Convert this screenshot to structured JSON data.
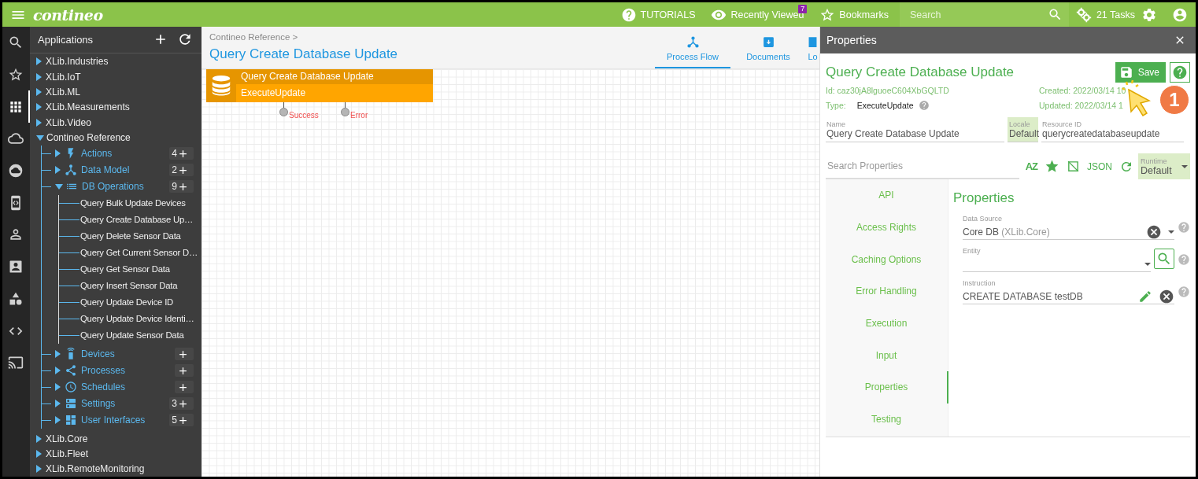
{
  "topbar": {
    "logo": "contineo",
    "links": [
      {
        "kind": "help",
        "label": "TUTORIALS"
      },
      {
        "kind": "eye",
        "label": "Recently Viewed",
        "badge": "7"
      },
      {
        "kind": "star",
        "label": "Bookmarks"
      }
    ],
    "search": {
      "placeholder": "Search"
    },
    "tasks": "21 Tasks"
  },
  "rail": [
    {
      "kind": "search",
      "selected": false
    },
    {
      "kind": "star",
      "selected": false
    },
    {
      "kind": "apps",
      "selected": true
    },
    {
      "kind": "cloud",
      "selected": false
    },
    {
      "kind": "cloudcircle",
      "selected": false
    },
    {
      "kind": "codebox",
      "selected": false
    },
    {
      "kind": "person",
      "selected": false
    },
    {
      "kind": "contact",
      "selected": false
    },
    {
      "kind": "shapes",
      "selected": false
    },
    {
      "kind": "code",
      "selected": false
    },
    {
      "kind": "cast",
      "selected": false
    }
  ],
  "tree": {
    "title": "Applications",
    "items": [
      {
        "label": "XLib.Industries",
        "expanded": false
      },
      {
        "label": "XLib.IoT",
        "expanded": false
      },
      {
        "label": "XLib.ML",
        "expanded": false
      },
      {
        "label": "XLib.Measurements",
        "expanded": false
      },
      {
        "label": "XLib.Video",
        "expanded": false
      },
      {
        "label": "Contineo Reference",
        "expanded": true,
        "children": [
          {
            "kind": "bolt",
            "label": "Actions",
            "expanded": false,
            "count": "4"
          },
          {
            "kind": "fork",
            "label": "Data Model",
            "expanded": false,
            "count": "2"
          },
          {
            "kind": "list",
            "label": "DB Operations",
            "expanded": true,
            "count": "9",
            "children": [
              {
                "label": "Query Bulk Update Devices"
              },
              {
                "label": "Query Create Database Up…"
              },
              {
                "label": "Query Delete Sensor Data"
              },
              {
                "label": "Query Get Current Sensor D…"
              },
              {
                "label": "Query Get Sensor Data"
              },
              {
                "label": "Query Insert Sensor Data"
              },
              {
                "label": "Query Update Device ID"
              },
              {
                "label": "Query Update Device Identi…"
              },
              {
                "label": "Query Update Sensor Data"
              }
            ]
          },
          {
            "kind": "remote",
            "label": "Devices",
            "expanded": false
          },
          {
            "kind": "share",
            "label": "Processes",
            "expanded": false
          },
          {
            "kind": "clock",
            "label": "Schedules",
            "expanded": false
          },
          {
            "kind": "server",
            "label": "Settings",
            "expanded": false,
            "count": "3"
          },
          {
            "kind": "dashboard",
            "label": "User Interfaces",
            "expanded": false,
            "count": "5"
          }
        ]
      },
      {
        "label": "XLib.Core",
        "expanded": false
      },
      {
        "label": "XLib.Fleet",
        "expanded": false
      },
      {
        "label": "XLib.RemoteMonitoring",
        "expanded": false
      }
    ]
  },
  "canvas": {
    "breadcrumb": "Contineo Reference >",
    "title": "Query Create Database Update",
    "tabs": [
      {
        "kind": "flow",
        "label": "Process Flow",
        "selected": true
      },
      {
        "kind": "download",
        "label": "Documents",
        "selected": false
      },
      {
        "kind": "doc",
        "label": "Lo",
        "selected": false
      }
    ],
    "node": {
      "title": "Query Create Database Update",
      "subtitle": "ExecuteUpdate",
      "ports": [
        "Success",
        "Error"
      ]
    }
  },
  "properties": {
    "header": "Properties",
    "title": "Query Create Database Update",
    "save": "Save",
    "id": "Id: caz30jA8lguoeC604XbGQLTD",
    "type_label": "Type:",
    "type_value": "ExecuteUpdate",
    "created": "Created: 2022/03/14 10",
    "updated": "Updated: 2022/03/14 1",
    "fields": [
      {
        "label": "Name",
        "value": "Query Create Database Update"
      },
      {
        "label": "Locale",
        "value": "Default"
      },
      {
        "label": "Resource ID",
        "value": "querycreatedatabaseupdate"
      }
    ],
    "search": {
      "placeholder": "Search Properties"
    },
    "sort": "AZ",
    "json": "JSON",
    "runtime": {
      "label": "Runtime",
      "value": "Default"
    },
    "nav": [
      {
        "label": "API",
        "selected": false
      },
      {
        "label": "Access Rights",
        "selected": false
      },
      {
        "label": "Caching Options",
        "selected": false
      },
      {
        "label": "Error Handling",
        "selected": false
      },
      {
        "label": "Execution",
        "selected": false
      },
      {
        "label": "Input",
        "selected": false
      },
      {
        "label": "Properties",
        "selected": true
      },
      {
        "label": "Testing",
        "selected": false
      }
    ],
    "section": "Properties",
    "props": [
      {
        "kind": "select",
        "label": "Data Source",
        "value": "Core DB",
        "hint": "(XLib.Core)"
      },
      {
        "kind": "lookup",
        "label": "Entity"
      },
      {
        "kind": "code",
        "label": "Instruction",
        "value": "CREATE DATABASE testDB"
      }
    ]
  },
  "callout": "1"
}
